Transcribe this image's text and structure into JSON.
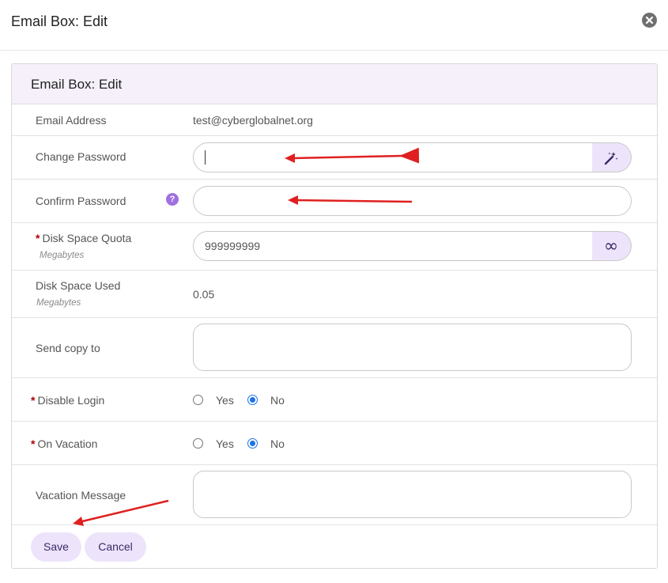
{
  "modal": {
    "title": "Email Box: Edit"
  },
  "panel": {
    "title": "Email Box: Edit"
  },
  "fields": {
    "email_address": {
      "label": "Email Address",
      "value": "test@cyberglobalnet.org"
    },
    "change_password": {
      "label": "Change Password",
      "value": "",
      "icon": "magic-wand-icon"
    },
    "confirm_password": {
      "label": "Confirm Password",
      "value": "",
      "help": "?"
    },
    "disk_quota": {
      "label": "Disk Space Quota",
      "required": "*",
      "unit": "Megabytes",
      "value": "999999999",
      "addon": "∞"
    },
    "disk_used": {
      "label": "Disk Space Used",
      "unit": "Megabytes",
      "value": "0.05"
    },
    "send_copy": {
      "label": "Send copy to",
      "value": ""
    },
    "disable_login": {
      "label": "Disable Login",
      "required": "*",
      "yes": "Yes",
      "no": "No",
      "selected": "No"
    },
    "on_vacation": {
      "label": "On Vacation",
      "required": "*",
      "yes": "Yes",
      "no": "No",
      "selected": "No"
    },
    "vacation_message": {
      "label": "Vacation Message",
      "value": ""
    }
  },
  "buttons": {
    "save": "Save",
    "cancel": "Cancel"
  },
  "colors": {
    "accent_bg": "#ede4fb",
    "header_bg": "#f5f0fa",
    "annotation": "#e02020",
    "radio": "#1a73e8"
  }
}
